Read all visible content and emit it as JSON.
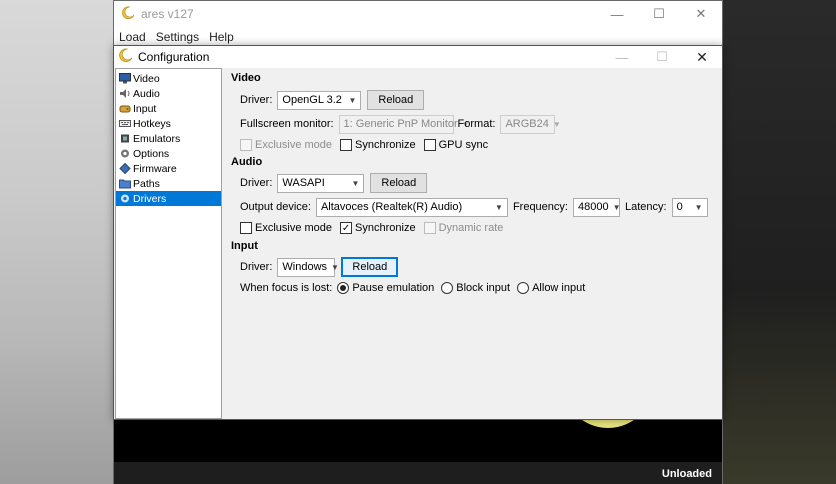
{
  "ares": {
    "title": "ares v127",
    "menu": [
      "Load",
      "Settings",
      "Help"
    ],
    "status": "Unloaded",
    "controls": {
      "minimize": "—",
      "maximize": "☐",
      "close": "✕"
    }
  },
  "config": {
    "title": "Configuration",
    "controls": {
      "minimize": "—",
      "maximize": "☐",
      "close": "✕"
    },
    "nav": [
      {
        "label": "Video",
        "icon": "monitor-icon"
      },
      {
        "label": "Audio",
        "icon": "speaker-icon"
      },
      {
        "label": "Input",
        "icon": "gamepad-icon"
      },
      {
        "label": "Hotkeys",
        "icon": "keyboard-icon"
      },
      {
        "label": "Emulators",
        "icon": "chip-icon"
      },
      {
        "label": "Options",
        "icon": "gear-icon"
      },
      {
        "label": "Firmware",
        "icon": "diamond-icon"
      },
      {
        "label": "Paths",
        "icon": "folder-icon"
      },
      {
        "label": "Drivers",
        "icon": "gear-icon",
        "selected": true
      }
    ],
    "video": {
      "heading": "Video",
      "driver_label": "Driver:",
      "driver_value": "OpenGL 3.2",
      "reload": "Reload",
      "fullscreen_label": "Fullscreen monitor:",
      "fullscreen_value": "1: Generic PnP Monitor",
      "format_label": "Format:",
      "format_value": "ARGB24",
      "exclusive": "Exclusive mode",
      "synchronize": "Synchronize",
      "gpu_sync": "GPU sync"
    },
    "audio": {
      "heading": "Audio",
      "driver_label": "Driver:",
      "driver_value": "WASAPI",
      "reload": "Reload",
      "output_label": "Output device:",
      "output_value": "Altavoces (Realtek(R) Audio)",
      "frequency_label": "Frequency:",
      "frequency_value": "48000",
      "latency_label": "Latency:",
      "latency_value": "0",
      "exclusive": "Exclusive mode",
      "synchronize": "Synchronize",
      "dynamic_rate": "Dynamic rate"
    },
    "input": {
      "heading": "Input",
      "driver_label": "Driver:",
      "driver_value": "Windows",
      "reload": "Reload",
      "focus_label": "When focus is lost:",
      "pause": "Pause emulation",
      "block": "Block input",
      "allow": "Allow input"
    }
  },
  "colors": {
    "selection": "#0078d7",
    "disc": "#e7e37c"
  }
}
